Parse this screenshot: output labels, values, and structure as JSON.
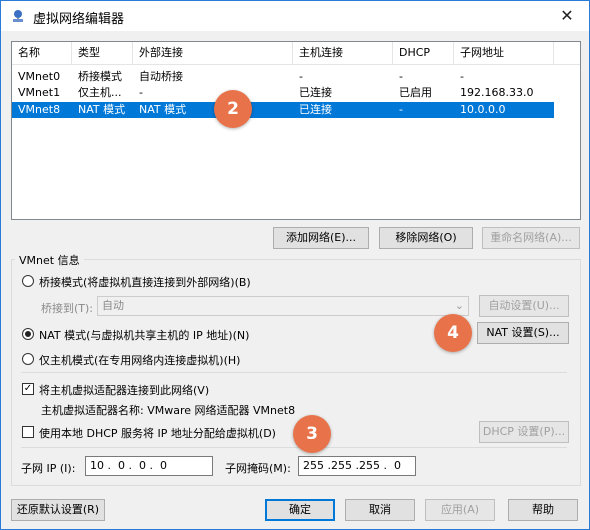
{
  "window": {
    "title": "虚拟网络编辑器"
  },
  "table": {
    "columns": [
      "名称",
      "类型",
      "外部连接",
      "主机连接",
      "DHCP",
      "子网地址"
    ],
    "rows": [
      [
        "VMnet0",
        "桥接模式",
        "自动桥接",
        "-",
        "-",
        "-"
      ],
      [
        "VMnet1",
        "仅主机...",
        "-",
        "已连接",
        "已启用",
        "192.168.33.0"
      ],
      [
        "VMnet8",
        "NAT 模式",
        "NAT 模式",
        "已连接",
        "-",
        "10.0.0.0"
      ]
    ],
    "selected_row": 2
  },
  "table_buttons": {
    "add": "添加网络(E)...",
    "remove": "移除网络(O)",
    "rename": "重命名网络(A)..."
  },
  "vmnet_info": {
    "group_title": "VMnet 信息",
    "bridge_mode": "桥接模式(将虚拟机直接连接到外部网络)(B)",
    "bridge_to_label": "桥接到(T):",
    "bridge_to_value": "自动",
    "auto_settings": "自动设置(U)...",
    "nat_mode": "NAT 模式(与虚拟机共享主机的 IP 地址)(N)",
    "nat_settings": "NAT 设置(S)...",
    "host_only": "仅主机模式(在专用网络内连接虚拟机)(H)",
    "connect_adapter": "将主机虚拟适配器连接到此网络(V)",
    "adapter_name": "主机虚拟适配器名称: VMware 网络适配器 VMnet8",
    "use_dhcp": "使用本地 DHCP 服务将 IP 地址分配给虚拟机(D)",
    "dhcp_settings": "DHCP 设置(P)...",
    "subnet_ip_label": "子网 IP (I):",
    "subnet_ip_value": "10 .  0 .  0 .  0",
    "subnet_mask_label": "子网掩码(M):",
    "subnet_mask_value": "255 .255 .255 .  0"
  },
  "footer": {
    "restore": "还原默认设置(R)",
    "ok": "确定",
    "cancel": "取消",
    "apply": "应用(A)",
    "help": "帮助"
  },
  "annotations": [
    "2",
    "4",
    "3"
  ],
  "colors": {
    "selection": "#0078d7",
    "badge": "#e8734a"
  }
}
